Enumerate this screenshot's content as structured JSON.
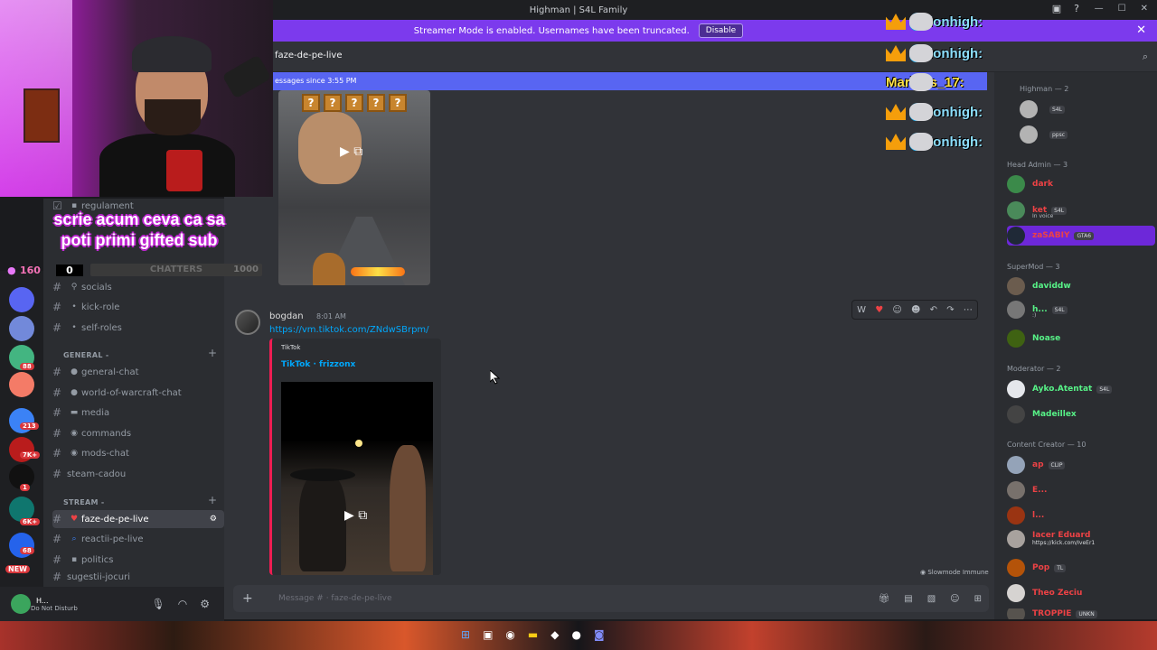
{
  "window": {
    "title": "Highman | S4L Family"
  },
  "banner": {
    "text": "Streamer Mode is enabled. Usernames have been truncated.",
    "button": "Disable"
  },
  "header": {
    "channel": "faze-de-pe-live"
  },
  "new_messages": {
    "text": "essages since 3:55 PM"
  },
  "overlay": {
    "text_line1": "scrie acum ceva ca sa",
    "text_line2": "poti primi gifted sub",
    "count1": "160",
    "count2": "0",
    "bar_label": "CHATTERS",
    "bar_max": "1000"
  },
  "alerts": [
    {
      "name": "lonhigh:"
    },
    {
      "name": "lonhigh:"
    },
    {
      "name": "Mariuss_17:"
    },
    {
      "name": "lonhigh:"
    },
    {
      "name": "lonhigh:"
    }
  ],
  "channels": {
    "top": [
      {
        "name": "regulament",
        "icon": "rules-icon"
      }
    ],
    "info": [
      {
        "name": "socials",
        "icon": "link-icon"
      },
      {
        "name": "kick-role",
        "icon": "gear-icon"
      },
      {
        "name": "self-roles",
        "icon": "gear-icon"
      }
    ],
    "general_category": "GENERAL -",
    "general": [
      {
        "name": "general-chat",
        "icon": "chat-icon"
      },
      {
        "name": "world-of-warcraft-chat",
        "icon": "chat-icon"
      },
      {
        "name": "media",
        "icon": "media-icon"
      },
      {
        "name": "commands",
        "icon": "bot-icon"
      },
      {
        "name": "mods-chat",
        "icon": "bot-icon"
      },
      {
        "name": "steam-cadou",
        "icon": ""
      }
    ],
    "stream_category": "STREAM -",
    "stream": [
      {
        "name": "faze-de-pe-live",
        "icon": "heart-icon"
      },
      {
        "name": "reactii-pe-live",
        "icon": "search-icon"
      },
      {
        "name": "politics",
        "icon": "doc-icon"
      },
      {
        "name": "sugestii-jocuri",
        "icon": ""
      }
    ]
  },
  "servers": {
    "badges": [
      "88",
      "213",
      "7K+",
      "1",
      "6K+",
      "68",
      "NEW"
    ]
  },
  "user_panel": {
    "name": "H...",
    "status": "Do Not Disturb"
  },
  "message": {
    "author": "bogdan",
    "time": "8:01 AM",
    "link": "https://vm.tiktok.com/ZNdwSBrpm/",
    "embed_provider": "TikTok",
    "embed_title": "TikTok · frizzonx"
  },
  "slowmode": "Slowmode Immune",
  "composer": {
    "placeholder": "Message # · faze-de-pe-live"
  },
  "members": {
    "groups": [
      {
        "label": "Highman — 2"
      },
      {
        "label": "Head Admin — 3"
      },
      {
        "label": "SuperMod — 3"
      },
      {
        "label": "Moderator — 2"
      },
      {
        "label": "Content Creator — 10"
      }
    ],
    "list": [
      {
        "name": "",
        "tag": "S4L",
        "color": "#f2f3f5"
      },
      {
        "name": "",
        "tag": "ppsc",
        "color": "#f2f3f5"
      },
      {
        "name": "dark",
        "tag": "",
        "color": "#ed4245"
      },
      {
        "name": "ket",
        "tag": "S4L",
        "sub": "In voice",
        "color": "#ed4245"
      },
      {
        "name": "zaSABIY",
        "tag": "GTA6",
        "color": "#ed4245"
      },
      {
        "name": "daviddw",
        "tag": "",
        "color": "#57f287"
      },
      {
        "name": "h...",
        "tag": "S4L",
        "sub": ":)",
        "color": "#57f287"
      },
      {
        "name": "Noase",
        "tag": "",
        "color": "#57f287"
      },
      {
        "name": "Ayko.Atentat",
        "tag": "S4L",
        "color": "#57f287"
      },
      {
        "name": "Madeillex",
        "tag": "",
        "color": "#57f287"
      },
      {
        "name": "ap",
        "tag": "CLIP",
        "color": "#ed4245"
      },
      {
        "name": "E...",
        "tag": "",
        "color": "#ed4245"
      },
      {
        "name": "l...",
        "tag": "",
        "color": "#ed4245"
      },
      {
        "name": "Iacer Eduard",
        "tag": "",
        "sub": "https://kick.com/IveEr1",
        "color": "#ed4245"
      },
      {
        "name": "Pop",
        "tag": "TL",
        "color": "#ed4245"
      },
      {
        "name": "Theo Zeciu",
        "tag": "",
        "color": "#ed4245"
      },
      {
        "name": "TROPPIE",
        "tag": "UNKN",
        "color": "#ed4245"
      }
    ]
  }
}
